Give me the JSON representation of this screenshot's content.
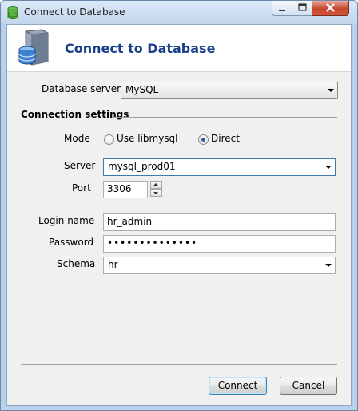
{
  "window": {
    "title": "Connect to Database"
  },
  "header": {
    "title": "Connect to Database"
  },
  "database_server": {
    "label": "Database server",
    "value": "MySQL"
  },
  "connection_settings": {
    "label": "Connection settings",
    "mode": {
      "label": "Mode",
      "options": [
        {
          "label": "Use libmysql",
          "selected": false
        },
        {
          "label": "Direct",
          "selected": true
        }
      ]
    },
    "server": {
      "label": "Server",
      "value": "mysql_prod01"
    },
    "port": {
      "label": "Port",
      "value": "3306"
    },
    "login_name": {
      "label": "Login name",
      "value": "hr_admin"
    },
    "password": {
      "label": "Password",
      "value": "••••••••••••••"
    },
    "schema": {
      "label": "Schema",
      "value": "hr"
    }
  },
  "buttons": {
    "connect": "Connect",
    "cancel": "Cancel"
  },
  "colors": {
    "header_title": "#1b3f8b",
    "window_frame": "#b9d1ea",
    "close_button": "#c7472f"
  },
  "icons": {
    "title": "database-icon",
    "header": "database-server-icon",
    "minimize": "minimize-icon",
    "maximize": "maximize-icon",
    "close": "close-icon"
  }
}
